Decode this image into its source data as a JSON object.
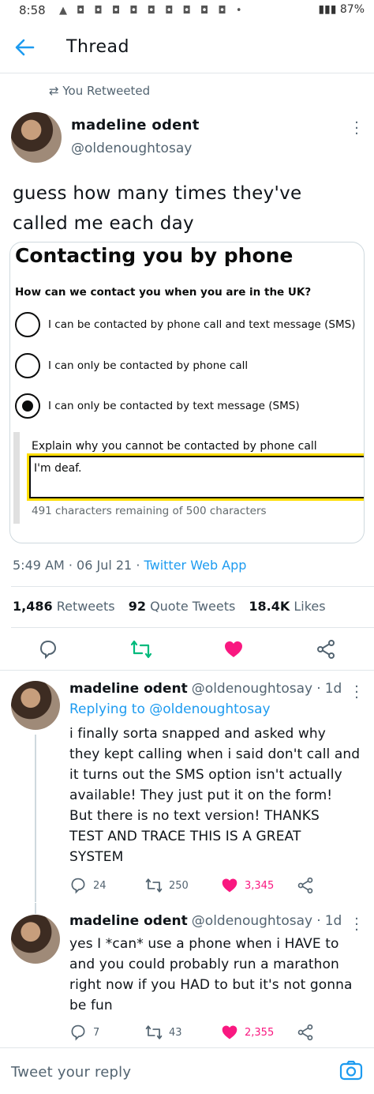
{
  "status_bar": {
    "time": "8:58",
    "notif_icons": "▲ ◘ ◘ ◘ ◘ ◘ ◘ ◘ ◘ ◘ •",
    "battery": "87%"
  },
  "header": {
    "title": "Thread"
  },
  "main_tweet": {
    "retweet_label": "You Retweeted",
    "author_name": "madeline odent",
    "author_handle": "@oldenoughtosay",
    "text_line1": "guess how many times they've",
    "text_line2": "called me each day",
    "form": {
      "title": "Contacting you by phone",
      "question": "How can we contact you when you are in the UK?",
      "options": [
        {
          "label": "I can be contacted by phone call and text message (SMS)",
          "selected": false
        },
        {
          "label": "I can only be contacted by phone call",
          "selected": false
        },
        {
          "label": "I can only be contacted by text message (SMS)",
          "selected": true
        }
      ],
      "explain_label": "Explain why you cannot be contacted by phone call",
      "explain_value": "I'm deaf.",
      "char_count": "491 characters remaining of 500 characters"
    },
    "time": "5:49 AM",
    "date": "06 Jul 21",
    "source": "Twitter Web App",
    "retweets_count": "1,486",
    "retweets_label": "Retweets",
    "quotes_count": "92",
    "quotes_label": "Quote Tweets",
    "likes_count": "18.4K",
    "likes_label": "Likes"
  },
  "replies": [
    {
      "author_name": "madeline odent",
      "author_handle": "@oldenoughtosay",
      "age": "1d",
      "replying_prefix": "Replying to",
      "replying_to": "@oldenoughtosay",
      "lines": [
        "i finally sorta snapped and asked why",
        "they kept calling when i said don't call and",
        "it turns out the SMS option isn't actually",
        "available! They just put it on the form!",
        "But there is no text version! THANKS",
        "TEST AND TRACE THIS IS A GREAT",
        "SYSTEM"
      ],
      "replies": "24",
      "retweets": "250",
      "likes": "3,345"
    },
    {
      "author_name": "madeline odent",
      "author_handle": "@oldenoughtosay",
      "age": "1d",
      "lines": [
        "yes I *can* use a phone when i HAVE to",
        "and you could probably run a marathon",
        "right now if you HAD to but it's not gonna",
        "be fun"
      ],
      "replies": "7",
      "retweets": "43",
      "likes": "2,355"
    }
  ],
  "reply_bar": {
    "placeholder": "Tweet your reply"
  },
  "colors": {
    "accent": "#1d9bf0",
    "retweet_green": "#00ba7c",
    "like_pink": "#f91880",
    "muted": "#536471",
    "focus_yellow": "#ffdd00"
  }
}
